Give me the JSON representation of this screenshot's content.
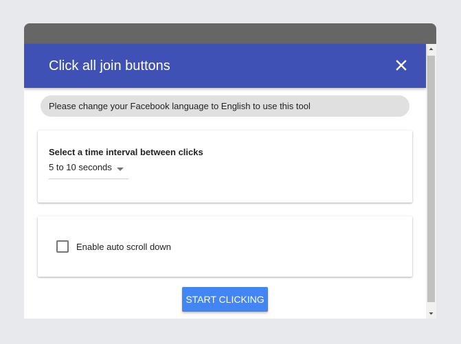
{
  "dialog": {
    "title": "Click all join buttons",
    "close_icon": "close-icon",
    "header_color": "#3f51b5"
  },
  "notice": {
    "text": "Please change your Facebook language to English to use this tool"
  },
  "interval": {
    "label": "Select a time interval between clicks",
    "selected": "5 to 10 seconds"
  },
  "auto_scroll": {
    "label": "Enable auto scroll down",
    "checked": false
  },
  "actions": {
    "start_label": "START CLICKING",
    "start_color": "#4285f4"
  }
}
